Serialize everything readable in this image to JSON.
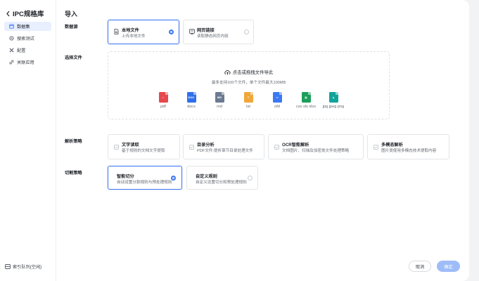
{
  "sidebar": {
    "title": "IPC规格库",
    "items": [
      {
        "label": "数据集",
        "icon": "database-icon",
        "active": true
      },
      {
        "label": "搜索测试",
        "icon": "search-test-icon",
        "active": false
      },
      {
        "label": "配置",
        "icon": "settings-icon",
        "active": false
      },
      {
        "label": "关联应用",
        "icon": "link-icon",
        "active": false
      }
    ],
    "footer": "索引队列(空闲)"
  },
  "page": {
    "title": "导入"
  },
  "data_source": {
    "label": "数据源",
    "options": [
      {
        "title": "本地文件",
        "desc": "上传本地文件",
        "selected": true
      },
      {
        "title": "网页链接",
        "desc": "读取静态网页内容",
        "selected": false
      }
    ]
  },
  "file_select": {
    "label": "选择文件",
    "upload_text": "点击或拖拽文件导此",
    "hint": "最多支持100个文件，单个文件最大100MB",
    "file_types": [
      {
        "label": "pdf",
        "color": "#e5484d",
        "icon": "pdf-file-icon"
      },
      {
        "label": "docx",
        "color": "#2f6fec",
        "icon": "docx-file-icon"
      },
      {
        "label": "md",
        "color": "#6b7a90",
        "icon": "md-file-icon"
      },
      {
        "label": "txt",
        "color": "#f0a73a",
        "icon": "txt-file-icon"
      },
      {
        "label": "ofd",
        "color": "#3c78f2",
        "icon": "ofd-file-icon"
      },
      {
        "label": "csv xls xlsx",
        "color": "#1e9e5a",
        "icon": "spreadsheet-file-icon"
      },
      {
        "label": "jpg jpeg png",
        "color": "#12a39a",
        "icon": "image-file-icon"
      }
    ]
  },
  "parse_strategy": {
    "label": "解析策略",
    "options": [
      {
        "title": "文字读取",
        "desc": "基于规则的文档文字提取"
      },
      {
        "title": "目录分析",
        "desc": "PDF文件:提析章节目录处理文件"
      },
      {
        "title": "OCR智能解析",
        "desc": "文档图片、扫描及加密类文件处理策略"
      },
      {
        "title": "多模态解析",
        "desc": "图片类使用多模态技术提取内容"
      }
    ]
  },
  "chunk_strategy": {
    "label": "切割策略",
    "options": [
      {
        "title": "智能切分",
        "desc": "自动设置分割规则与预处理规则",
        "selected": true
      },
      {
        "title": "自定义规则",
        "desc": "自定义设置切分和预处理规则",
        "selected": false
      }
    ]
  },
  "actions": {
    "cancel": "取消",
    "confirm": "确定"
  }
}
